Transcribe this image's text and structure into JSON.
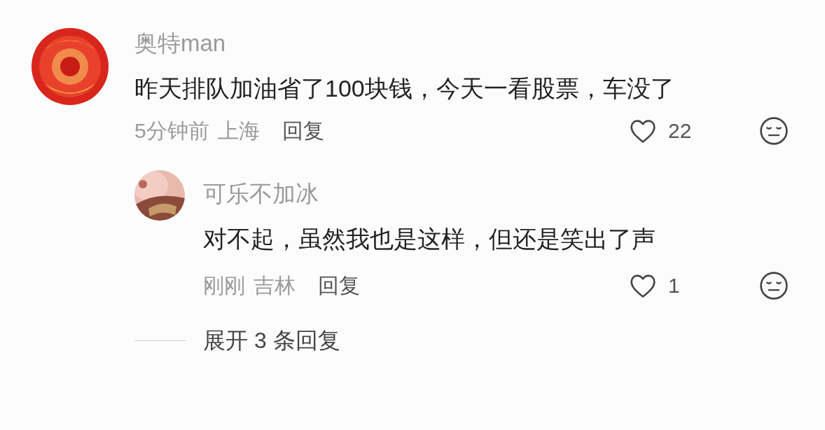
{
  "comment": {
    "author": "奥特man",
    "text": "昨天排队加油省了100块钱，今天一看股票，车没了",
    "time": "5分钟前",
    "location": "上海",
    "reply_label": "回复",
    "likes": "22",
    "liked": false,
    "replies": [
      {
        "author": "可乐不加冰",
        "text": "对不起，虽然我也是这样，但还是笑出了声",
        "time": "刚刚",
        "location": "吉林",
        "reply_label": "回复",
        "likes": "1",
        "liked": false
      }
    ],
    "expand_label": "展开 3 条回复"
  }
}
